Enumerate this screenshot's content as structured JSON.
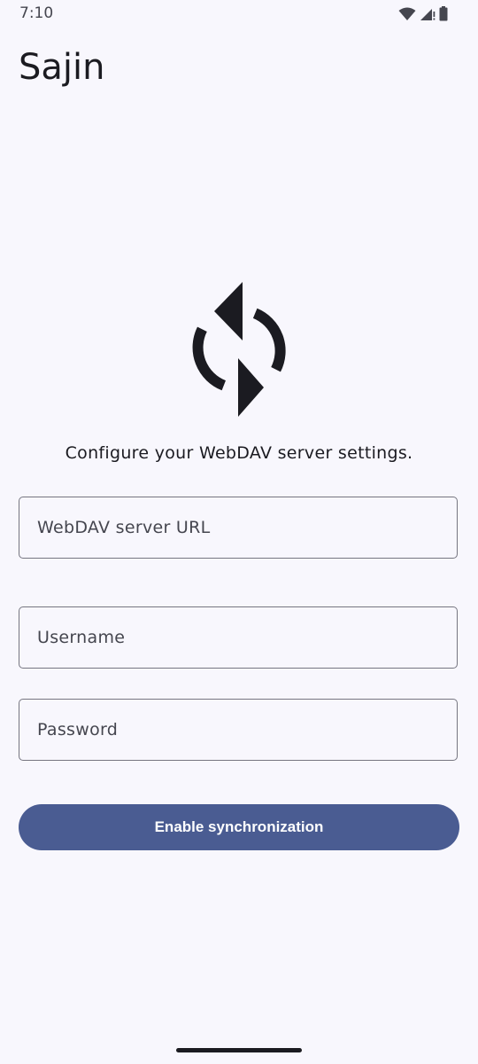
{
  "status_bar": {
    "time": "7:10",
    "icons": [
      "wifi-icon",
      "cellular-signal-icon",
      "battery-icon"
    ]
  },
  "app": {
    "title": "Sajin"
  },
  "main": {
    "icon": "sync-icon",
    "description": "Configure your WebDAV server settings.",
    "fields": {
      "url_placeholder": "WebDAV server URL",
      "username_placeholder": "Username",
      "password_placeholder": "Password"
    },
    "button_label": "Enable synchronization"
  },
  "colors": {
    "background": "#f8f7fd",
    "primary": "#4a5c92",
    "outline": "#767680",
    "text": "#1b1b21"
  }
}
